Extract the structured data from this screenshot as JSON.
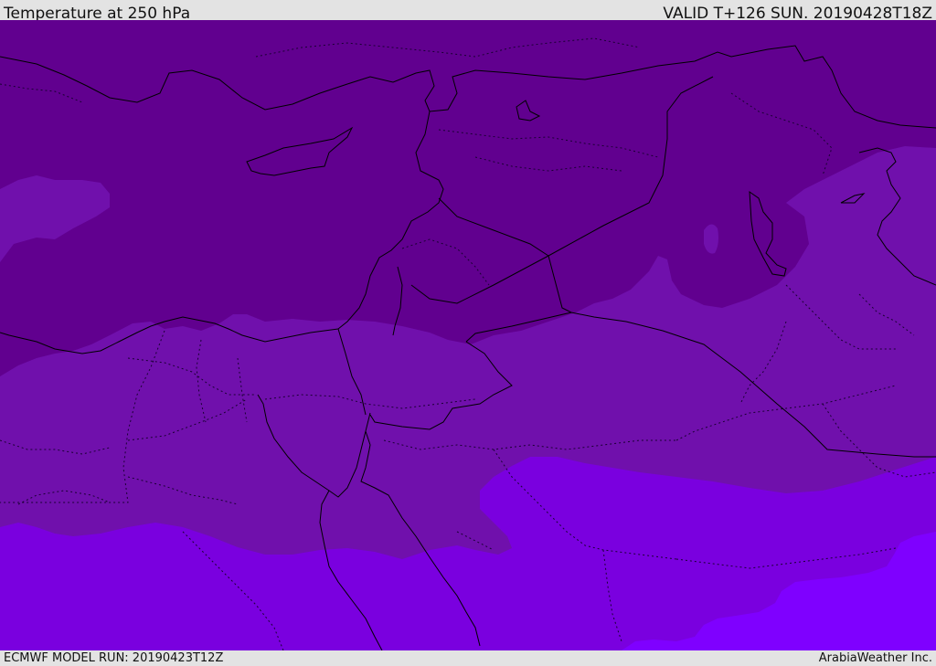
{
  "header": {
    "title": "Temperature at 250 hPa",
    "valid": "VALID T+126 SUN. 20190428T18Z"
  },
  "footer": {
    "run": "ECMWF MODEL RUN: 20190423T12Z",
    "credit": "ArabiaWeather Inc."
  },
  "map": {
    "field": "temperature",
    "level": "250 hPa",
    "shading_colors": {
      "darkest": "#61008f",
      "middle": "#7010ac",
      "lighter": "#7a00df",
      "lightest": "#7f00ff"
    },
    "line_colors": {
      "coastline": "#000000",
      "border": "#1a0033"
    }
  }
}
